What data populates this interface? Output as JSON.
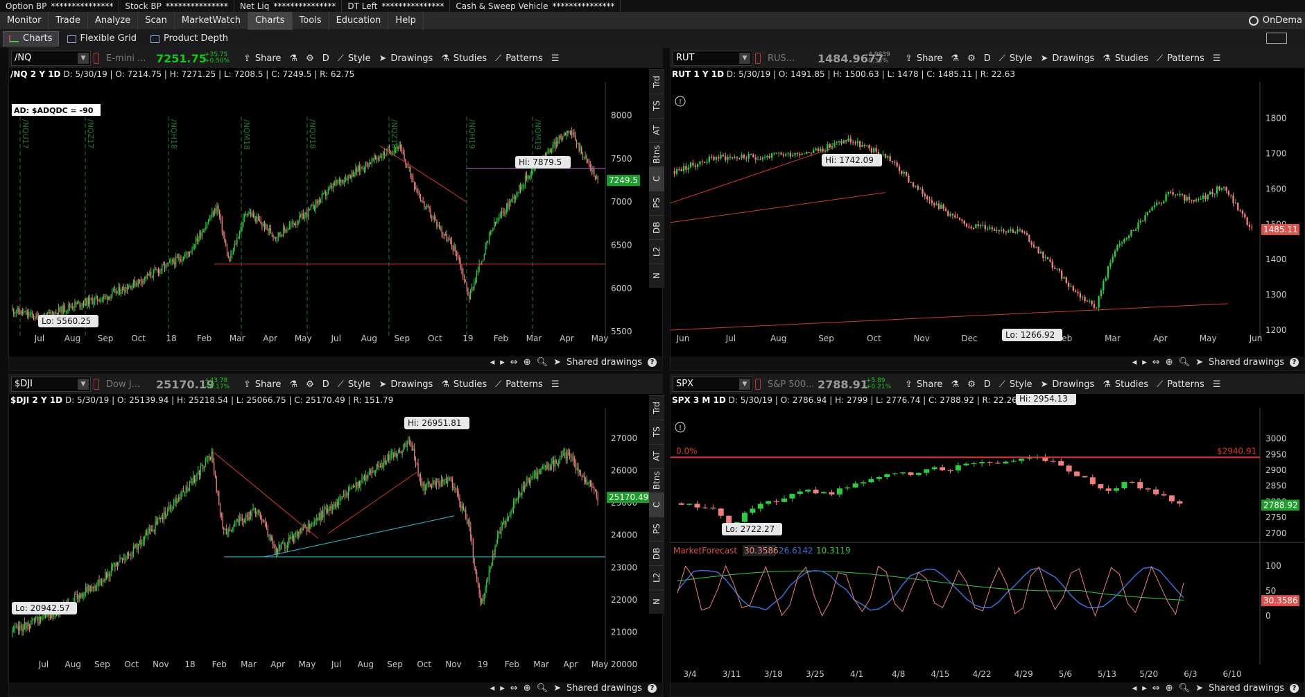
{
  "topbar": {
    "items": [
      {
        "label": "Option BP",
        "value": "***************"
      },
      {
        "label": "Stock BP",
        "value": "***************"
      },
      {
        "label": "Net Liq",
        "value": "***************"
      },
      {
        "label": "DT Left",
        "value": "***************"
      },
      {
        "label": "Cash & Sweep Vehicle",
        "value": "***************"
      }
    ]
  },
  "navbar": {
    "items": [
      "Monitor",
      "Trade",
      "Analyze",
      "Scan",
      "MarketWatch",
      "Charts",
      "Tools",
      "Education",
      "Help"
    ],
    "active": "Charts",
    "right_label": "OnDema"
  },
  "subbar": {
    "items": [
      "Charts",
      "Flexible Grid",
      "Product Depth"
    ]
  },
  "toolbar": {
    "share": "Share",
    "style": "Style",
    "drawings": "Drawings",
    "studies": "Studies",
    "patterns": "Patterns",
    "period": "D"
  },
  "side_tabs": [
    "Trd",
    "TS",
    "AT",
    "Btns",
    "C",
    "PS",
    "DB",
    "L2",
    "N"
  ],
  "footer": {
    "shared_drawings": "Shared drawings"
  },
  "panels": {
    "nq": {
      "symbol": "/NQ",
      "desc": "E-mini ...",
      "price": "7251.75",
      "chg1": "+35.75",
      "chg2": "+0.50%",
      "header_title": "/NQ 2 Y 1D",
      "date": "D: 5/30/19",
      "open": "O: 7214.75",
      "high": "H: 7271.25",
      "low": "L: 7208.5",
      "close": "C: 7249.5",
      "range": "R: 62.75",
      "ad_label": "AD: $ADQDC = -90",
      "hi_label": "Hi: 7879.5",
      "lo_label": "Lo: 5560.25",
      "last_badge": "7249.5",
      "y_ticks": [
        "8000",
        "7500",
        "7000",
        "6500",
        "6000",
        "5500"
      ],
      "x_ticks": [
        "Jul",
        "Aug",
        "Sep",
        "Oct",
        "18",
        "Feb",
        "Mar",
        "Apr",
        "May",
        "Jul",
        "Aug",
        "Sep",
        "Oct",
        "19",
        "Feb",
        "Mar",
        "Apr",
        "May"
      ],
      "expiry_labels": [
        "/NQU17",
        "/NQZ17",
        "/NQH18",
        "/NQM18",
        "/NQU18",
        "/NQZ18",
        "/NQH19",
        "/NQM19"
      ]
    },
    "rut": {
      "symbol": "RUT",
      "desc": "RUS...",
      "price": "1484.9677",
      "chg1": "-4.9839",
      "chg2": "-0.33%",
      "header_title": "RUT 1 Y 1D",
      "date": "D: 5/30/19",
      "open": "O: 1491.85",
      "high": "H: 1500.63",
      "low": "L: 1478",
      "close": "C: 1485.11",
      "range": "R: 22.63",
      "hi_label": "Hi: 1742.09",
      "lo_label": "Lo: 1266.92",
      "last_badge": "1485.11",
      "y_ticks": [
        "1800",
        "1700",
        "1600",
        "1500",
        "1400",
        "1300",
        "1200"
      ],
      "x_ticks": [
        "Jun",
        "Jul",
        "Aug",
        "Sep",
        "Oct",
        "Nov",
        "Dec",
        "19",
        "Feb",
        "Mar",
        "Apr",
        "May",
        "Jun"
      ]
    },
    "dji": {
      "symbol": "$DJI",
      "desc": "Dow J...",
      "price": "25170.19",
      "chg1": "+43.78",
      "chg2": "+0.17%",
      "header_title": "$DJI 2 Y 1D",
      "date": "D: 5/30/19",
      "open": "O: 25139.94",
      "high": "H: 25218.54",
      "low": "L: 25066.75",
      "close": "C: 25170.49",
      "range": "R: 151.79",
      "hi_label": "Hi: 26951.81",
      "lo_label": "Lo: 20942.57",
      "last_badge": "25170.49",
      "y_ticks": [
        "27000",
        "26000",
        "25000",
        "24000",
        "23000",
        "22000",
        "21000",
        "20000"
      ],
      "x_ticks": [
        "Jul",
        "Aug",
        "Sep",
        "Oct",
        "Nov",
        "18",
        "Feb",
        "Mar",
        "Apr",
        "May",
        "Jul",
        "Aug",
        "Sep",
        "Oct",
        "Nov",
        "19",
        "Feb",
        "Mar",
        "Apr",
        "May"
      ]
    },
    "spx": {
      "symbol": "SPX",
      "desc": "S&P 500...",
      "price": "2788.91",
      "chg1": "+5.89",
      "chg2": "+0.21%",
      "header_title": "SPX 3 M 1D",
      "date": "D: 5/30/19",
      "open": "O: 2786.94",
      "high": "H: 2799",
      "low": "L: 2776.74",
      "close": "C: 2788.92",
      "range": "R: 22.26",
      "hi_label": "Hi: 2954.13",
      "lo_label": "Lo: 2722.27",
      "last_badge": "2788.92",
      "fib_label": "0.0%",
      "fib_value": "$2940.91",
      "y_ticks": [
        "3000",
        "2950",
        "2900",
        "2850",
        "2800",
        "2750",
        "2700"
      ],
      "x_ticks": [
        "3/4",
        "3/11",
        "3/18",
        "3/25",
        "4/1",
        "4/8",
        "4/15",
        "4/22",
        "4/29",
        "5/6",
        "5/13",
        "5/20",
        "6/3",
        "6/10"
      ],
      "mf_name": "MarketForecast",
      "mf_v1": "30.3586",
      "mf_v2": "26.6142",
      "mf_v3": "10.3119",
      "mf_badge": "30.3586",
      "mf_ticks": [
        "100",
        "50",
        "0"
      ]
    }
  }
}
